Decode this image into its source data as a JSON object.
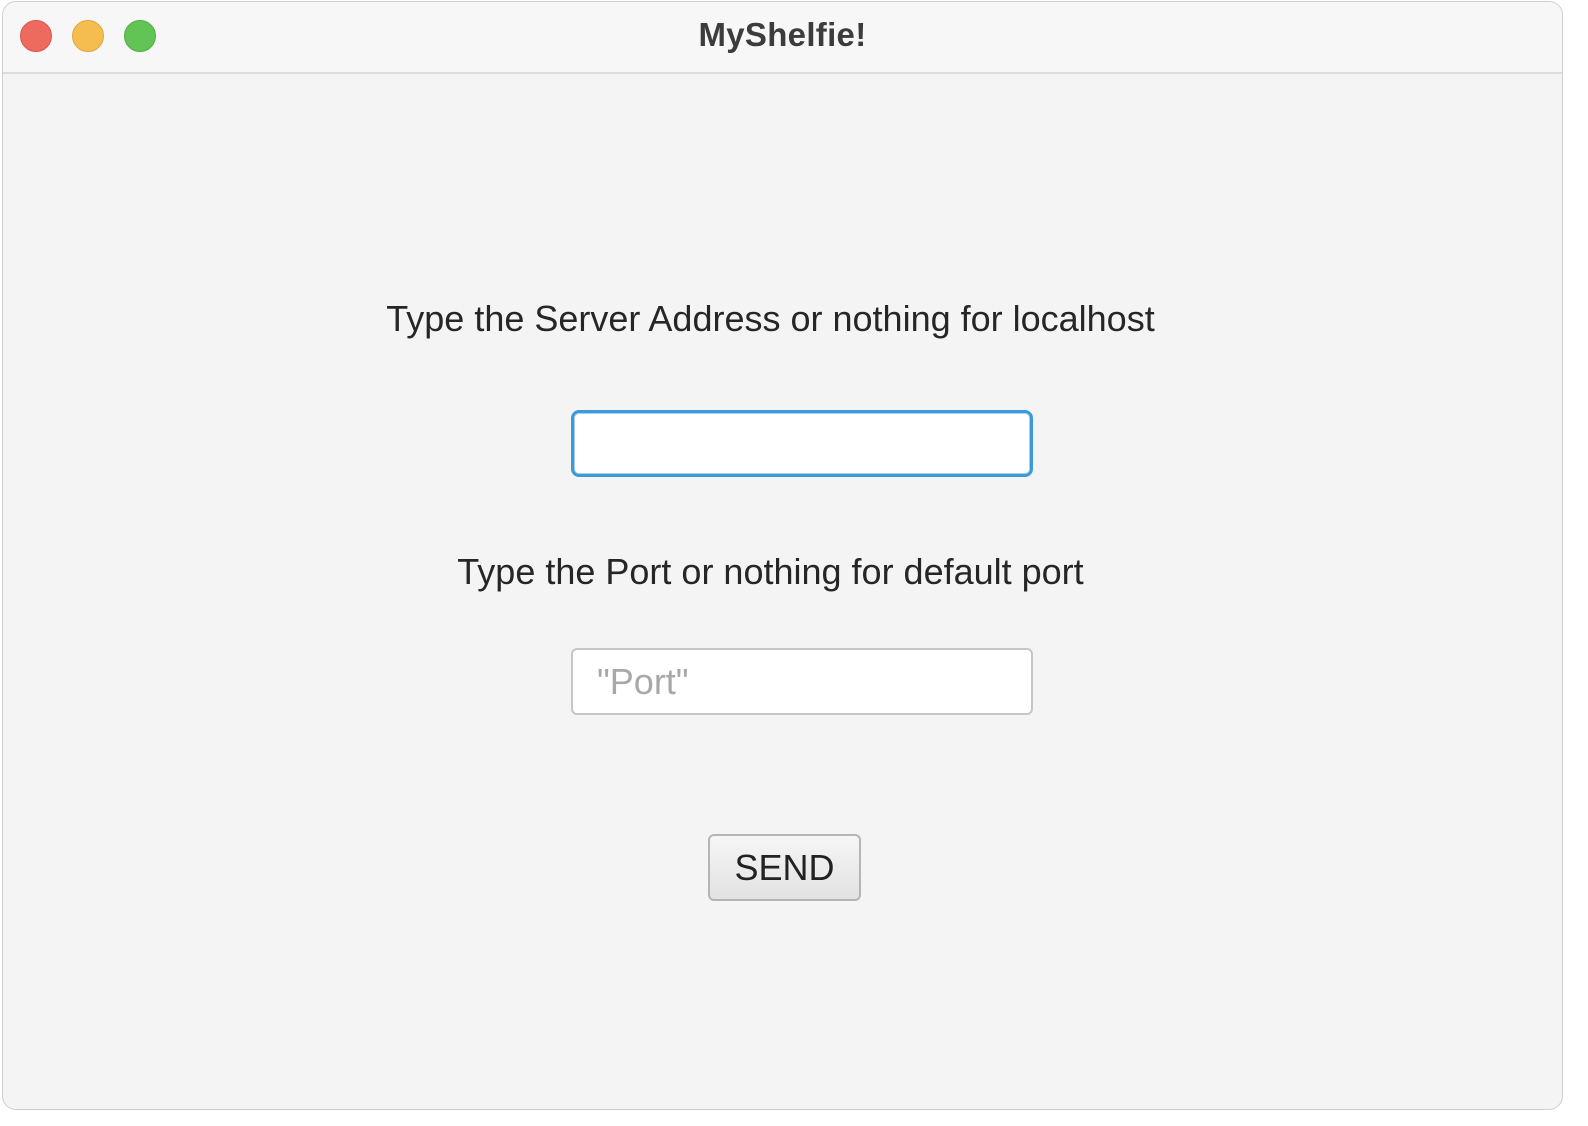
{
  "window": {
    "title": "MyShelfie!"
  },
  "form": {
    "server_label": "Type the Server Address or nothing for localhost",
    "server_value": "",
    "port_label": "Type the Port or nothing for default port",
    "port_value": "",
    "port_placeholder": "\"Port\"",
    "send_label": "SEND"
  },
  "colors": {
    "close": "#ee6a5e",
    "minimize": "#f5bd4f",
    "zoom": "#61c454",
    "focus_ring": "#3c9ad8"
  }
}
